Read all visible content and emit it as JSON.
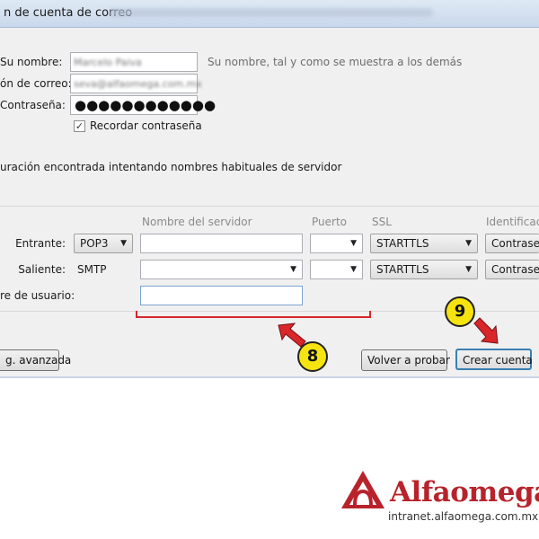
{
  "window": {
    "title": "n de cuenta de correo"
  },
  "form": {
    "name_label": "Su nombre:",
    "name_value": "Marcelo Paiva",
    "name_hint": "Su nombre, tal y como se muestra a los demás",
    "email_label": "ón de correo:",
    "email_value": "seva@alfaomega.com.mx",
    "password_label": "Contraseña:",
    "password_value": "●●●●●●●●●●●●",
    "remember_label": "Recordar contraseña",
    "remember_checked": "✓"
  },
  "status": {
    "message": "uración encontrada intentando nombres habituales de servidor"
  },
  "server": {
    "col_server": "Nombre del servidor",
    "col_port": "Puerto",
    "col_ssl": "SSL",
    "col_auth": "Identificació",
    "incoming_label": "Entrante:",
    "incoming_protocol": "POP3",
    "incoming_ssl": "STARTTLS",
    "incoming_auth": "Contraseñ",
    "outgoing_label": "Saliente:",
    "outgoing_protocol": "SMTP",
    "outgoing_ssl": "STARTTLS",
    "outgoing_auth": "Contraseñ",
    "username_label": "re de usuario:"
  },
  "buttons": {
    "advanced": "g. avanzada",
    "retry": "Volver a probar",
    "create": "Crear cuenta"
  },
  "annotations": {
    "badge_8": "8",
    "badge_9": "9"
  },
  "branding": {
    "logo_name": "Alfaomega",
    "logo_url": "intranet.alfaomega.com.mx"
  },
  "colors": {
    "accent_red": "#d9262a",
    "badge_yellow": "#f5e40f",
    "logo_red": "#b8232b"
  }
}
